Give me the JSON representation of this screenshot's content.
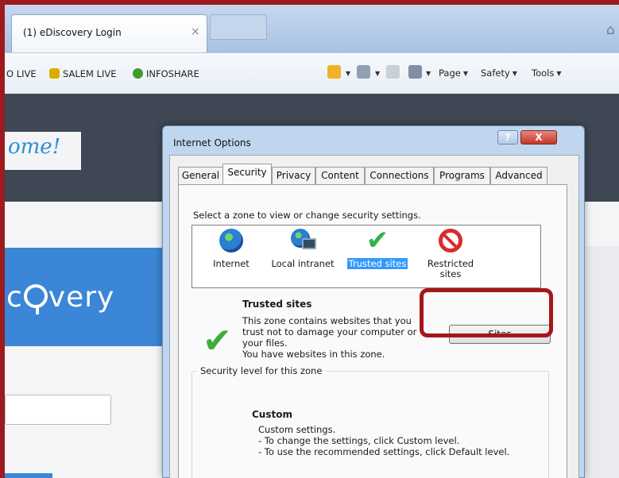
{
  "browser": {
    "tab_title": "eDiscovery Login",
    "tab_icon_glyph": "(1)",
    "tab_close": "×",
    "favorites": [
      {
        "label": "O LIVE",
        "color": ""
      },
      {
        "label": "SALEM LIVE",
        "color": "#d6b000"
      },
      {
        "label": "INFOSHARE",
        "color": "#3f9a2f"
      }
    ],
    "commands": [
      "Page",
      "Safety",
      "Tools"
    ]
  },
  "page": {
    "welcome_text": "ome!",
    "logo_left": "c",
    "logo_right": "very"
  },
  "dialog": {
    "title": "Internet Options",
    "help_label": "?",
    "close_label": "X",
    "tabs": [
      "General",
      "Security",
      "Privacy",
      "Content",
      "Connections",
      "Programs",
      "Advanced"
    ],
    "active_tab": "Security",
    "zone_prompt": "Select a zone to view or change security settings.",
    "zones": [
      {
        "label": "Internet",
        "icon": "globe-icon"
      },
      {
        "label": "Local intranet",
        "icon": "intranet-icon"
      },
      {
        "label": "Trusted sites",
        "icon": "checkmark-icon",
        "selected": true
      },
      {
        "label": "Restricted sites",
        "label_line1": "Restricted",
        "label_line2": "sites",
        "icon": "no-entry-icon"
      }
    ],
    "selected_zone": {
      "name": "Trusted sites",
      "desc_lines": [
        "This zone contains websites that you",
        "trust not to damage your computer or",
        "your files.",
        "You have websites in this zone."
      ]
    },
    "sites_button": "Sites",
    "security_level": {
      "legend": "Security level for this zone",
      "name": "Custom",
      "desc_lines": [
        "Custom settings.",
        "- To change the settings, click Custom level.",
        "- To use the recommended settings, click Default level."
      ]
    }
  },
  "colors": {
    "highlight": "#a5161b",
    "selection": "#3399ff",
    "brand_blue": "#3b86d6"
  }
}
